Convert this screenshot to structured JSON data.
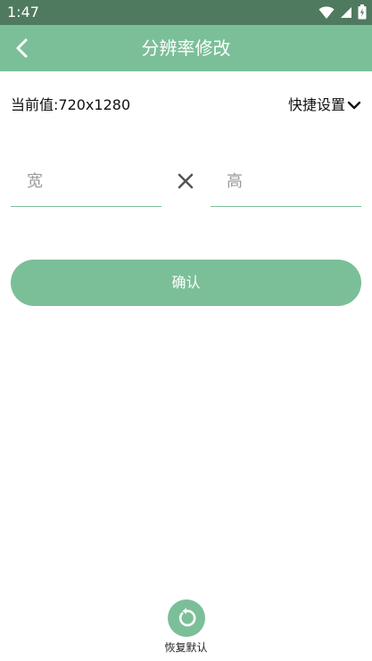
{
  "status_bar": {
    "time": "1:47"
  },
  "app_bar": {
    "title": "分辨率修改",
    "back_icon": "chevron-left-icon"
  },
  "resolution": {
    "current_label": "当前值:720x1280",
    "quick_settings_label": "快捷设置",
    "width_placeholder": "宽",
    "height_placeholder": "高",
    "width_value": "",
    "height_value": ""
  },
  "actions": {
    "confirm_label": "确认",
    "restore_label": "恢复默认",
    "restore_icon": "restore-icon"
  },
  "colors": {
    "primary": "#7bbf98",
    "status_bar": "#4f7a5f",
    "text": "#111111",
    "placeholder": "#9a9a9a"
  }
}
